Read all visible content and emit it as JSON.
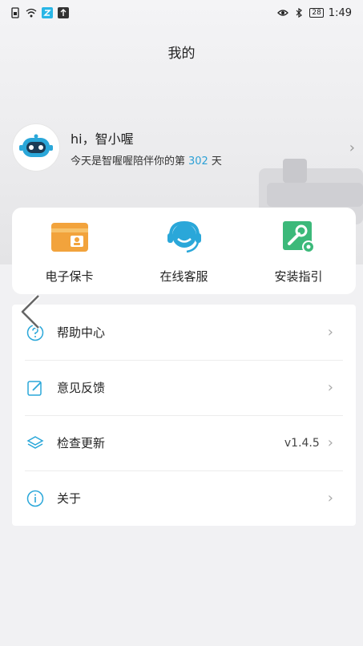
{
  "statusbar": {
    "time": "1:49",
    "battery": "28"
  },
  "header": {
    "title": "我的"
  },
  "profile": {
    "greeting": "hi，智小喔",
    "days_prefix": "今天是智喔喔陪伴你的第",
    "days_count": "302",
    "days_suffix": "天"
  },
  "quick_actions": [
    {
      "label": "电子保卡",
      "icon": "warranty-card-icon"
    },
    {
      "label": "在线客服",
      "icon": "customer-service-icon"
    },
    {
      "label": "安装指引",
      "icon": "install-guide-icon"
    }
  ],
  "menu": [
    {
      "label": "帮助中心",
      "icon": "help-icon",
      "value": ""
    },
    {
      "label": "意见反馈",
      "icon": "feedback-icon",
      "value": ""
    },
    {
      "label": "检查更新",
      "icon": "update-layers-icon",
      "value": "v1.4.5"
    },
    {
      "label": "关于",
      "icon": "info-icon",
      "value": ""
    }
  ],
  "colors": {
    "accent": "#2ba0d6",
    "card_orange": "#f2a33c",
    "guide_green": "#3cb97a"
  }
}
